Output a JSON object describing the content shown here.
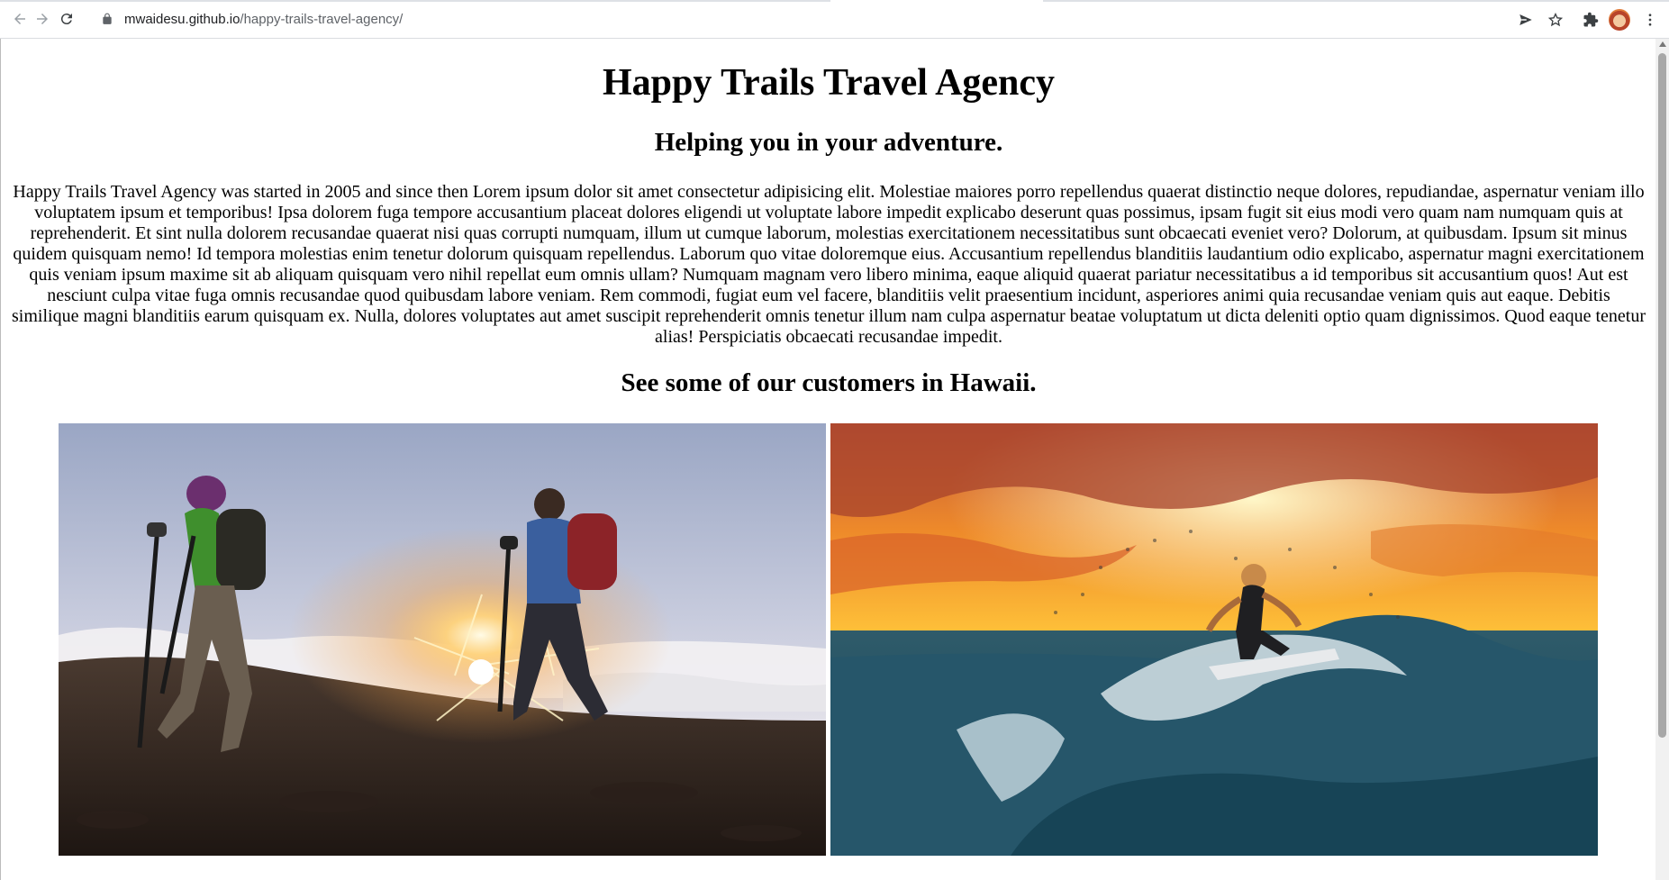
{
  "browser": {
    "url_host": "mwaidesu.github.io",
    "url_path": "/happy-trails-travel-agency/",
    "back_icon": "arrow-left-icon",
    "forward_icon": "arrow-right-icon",
    "reload_icon": "reload-icon",
    "lock_icon": "lock-icon",
    "send_icon": "send-icon",
    "bookmark_icon": "star-icon",
    "extensions_icon": "puzzle-icon",
    "menu_icon": "kebab-menu-icon"
  },
  "page": {
    "title": "Happy Trails Travel Agency",
    "subtitle": "Helping you in your adventure.",
    "intro": "Happy Trails Travel Agency was started in 2005 and since then Lorem ipsum dolor sit amet consectetur adipisicing elit. Molestiae maiores porro repellendus quaerat distinctio neque dolores, repudiandae, aspernatur veniam illo voluptatem ipsum et temporibus! Ipsa dolorem fuga tempore accusantium placeat dolores eligendi ut voluptate labore impedit explicabo deserunt quas possimus, ipsam fugit sit eius modi vero quam nam numquam quis at reprehenderit. Et sint nulla dolorem recusandae quaerat nisi quas corrupti numquam, illum ut cumque laborum, molestias exercitationem necessitatibus sunt obcaecati eveniet vero? Dolorum, at quibusdam. Ipsum sit minus quidem quisquam nemo! Id tempora molestias enim tenetur dolorum quisquam repellendus. Laborum quo vitae doloremque eius. Accusantium repellendus blanditiis laudantium odio explicabo, aspernatur magni exercitationem quis veniam ipsum maxime sit ab aliquam quisquam vero nihil repellat eum omnis ullam? Numquam magnam vero libero minima, eaque aliquid quaerat pariatur necessitatibus a id temporibus sit accusantium quos! Aut est nesciunt culpa vitae fuga omnis recusandae quod quibusdam labore veniam. Rem commodi, fugiat eum vel facere, blanditiis velit praesentium incidunt, asperiores animi quia recusandae veniam quis aut eaque. Debitis similique magni blanditiis earum quisquam ex. Nulla, dolores voluptates aut amet suscipit reprehenderit omnis tenetur illum nam culpa aspernatur beatae voluptatum ut dicta deleniti optio quam dignissimos. Quod eaque tenetur alias! Perspiciatis obcaecati recusandae impedit.",
    "section_heading": "See some of our customers in Hawaii."
  },
  "colors": {
    "chrome_bg": "#ffffff",
    "icon_gray": "#5f6368",
    "text": "#000000"
  }
}
